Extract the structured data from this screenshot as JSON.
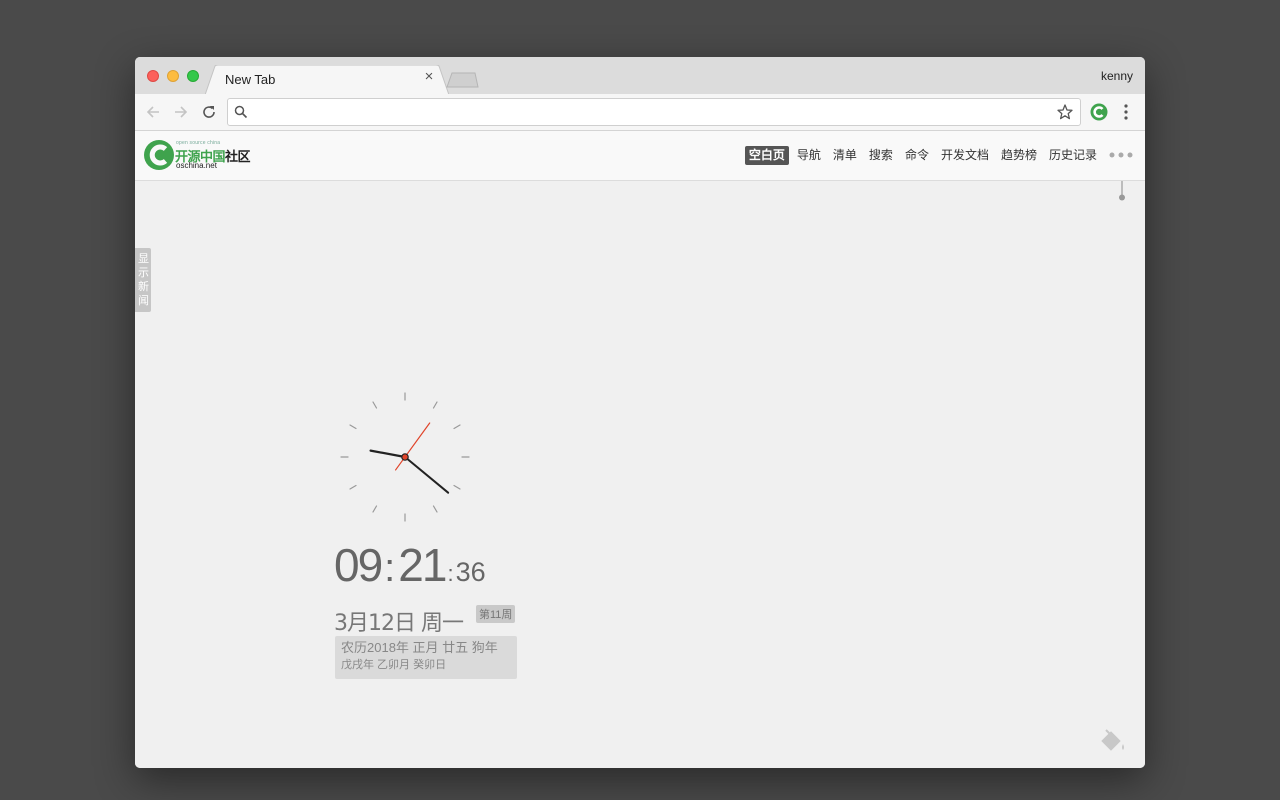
{
  "browser": {
    "tab_title": "New Tab",
    "profile_name": "kenny",
    "address_value": "",
    "address_placeholder": ""
  },
  "site": {
    "logo_small": "open source china",
    "logo_main_green": "开源中国",
    "logo_main_dark": "社区",
    "logo_url": "oschina.net",
    "nav": [
      {
        "label": "空白页",
        "active": true
      },
      {
        "label": "导航"
      },
      {
        "label": "清单"
      },
      {
        "label": "搜索"
      },
      {
        "label": "命令"
      },
      {
        "label": "开发文档"
      },
      {
        "label": "趋势榜"
      },
      {
        "label": "历史记录"
      }
    ],
    "news_tab": "显示新闻"
  },
  "clock": {
    "hours": "09",
    "minutes": "21",
    "seconds": "36",
    "date": "3月12日 周一",
    "week": "第11周",
    "lunar_line1": "农历2018年 正月 廿五 狗年",
    "lunar_line2": "戊戌年 乙卯月 癸卯日"
  },
  "colors": {
    "accent_green": "#3fa34d",
    "second_hand": "#e0442a",
    "active_nav_bg": "#555555"
  },
  "icons": [
    "back-icon",
    "forward-icon",
    "reload-icon",
    "search-icon",
    "star-icon",
    "extension-icon",
    "menu-icon",
    "more-icon",
    "paint-bucket-icon"
  ]
}
